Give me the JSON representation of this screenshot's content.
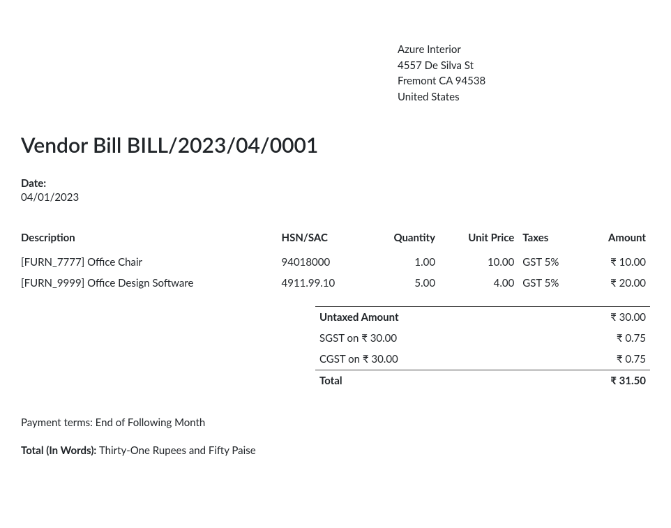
{
  "vendor": {
    "name": "Azure Interior",
    "street": "4557 De Silva St",
    "city_line": "Fremont CA 94538",
    "country": "United States"
  },
  "title": "Vendor Bill BILL/2023/04/0001",
  "date": {
    "label": "Date:",
    "value": "04/01/2023"
  },
  "columns": {
    "description": "Description",
    "hsn": "HSN/SAC",
    "quantity": "Quantity",
    "unit_price": "Unit Price",
    "taxes": "Taxes",
    "amount": "Amount"
  },
  "lines": [
    {
      "description": "[FURN_7777] Office Chair",
      "hsn": "94018000",
      "quantity": "1.00",
      "unit_price": "10.00",
      "taxes": "GST 5%",
      "amount": "₹ 10.00"
    },
    {
      "description": "[FURN_9999] Office Design Software",
      "hsn": "4911.99.10",
      "quantity": "5.00",
      "unit_price": "4.00",
      "taxes": "GST 5%",
      "amount": "₹ 20.00"
    }
  ],
  "totals": {
    "untaxed": {
      "label": "Untaxed Amount",
      "value": "₹ 30.00"
    },
    "sgst": {
      "label": "SGST on ₹ 30.00",
      "value": "₹ 0.75"
    },
    "cgst": {
      "label": "CGST on ₹ 30.00",
      "value": "₹ 0.75"
    },
    "grand": {
      "label": "Total",
      "value": "₹ 31.50"
    }
  },
  "payment_terms": {
    "label": "Payment terms: ",
    "value": "End of Following Month"
  },
  "total_in_words": {
    "label": "Total (In Words): ",
    "value": "Thirty-One Rupees and Fifty Paise"
  }
}
